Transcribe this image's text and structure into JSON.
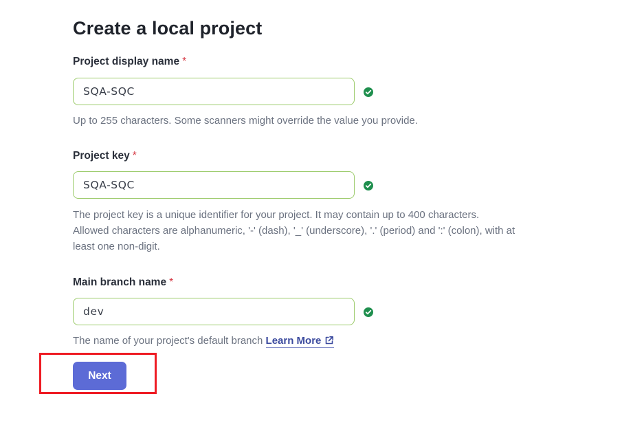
{
  "page": {
    "title": "Create a local project"
  },
  "required_marker": "*",
  "fields": {
    "display_name": {
      "label": "Project display name",
      "value": "SQA-SQC",
      "status_icon": "check-circle-icon",
      "help": "Up to 255 characters. Some scanners might override the value you provide."
    },
    "project_key": {
      "label": "Project key",
      "value": "SQA-SQC",
      "status_icon": "check-circle-icon",
      "help_lines": [
        "The project key is a unique identifier for your project. It may contain up to 400 characters.",
        "Allowed characters are alphanumeric, '-' (dash), '_' (underscore), '.' (period) and ':' (colon), with at",
        "least one non-digit."
      ]
    },
    "main_branch": {
      "label": "Main branch name",
      "value": "dev",
      "status_icon": "check-circle-icon",
      "help": "The name of your project's default branch",
      "link_label": "Learn More",
      "link_icon": "external-link-icon"
    }
  },
  "actions": {
    "next_label": "Next"
  },
  "colors": {
    "valid_border": "#9ccb6b",
    "valid_icon": "#1f8f4e",
    "primary": "#5c6bd6",
    "required": "#d4333f",
    "annotation_box": "#ee1c24"
  }
}
